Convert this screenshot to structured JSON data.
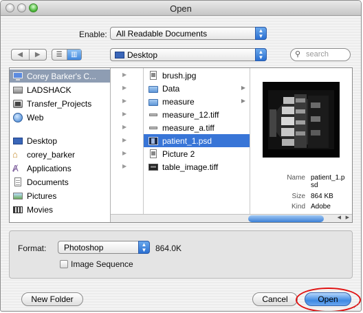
{
  "window": {
    "title": "Open"
  },
  "enable": {
    "label": "Enable:",
    "value": "All Readable Documents"
  },
  "location": {
    "value": "Desktop"
  },
  "search": {
    "placeholder": "search"
  },
  "sidebar": {
    "devices": [
      {
        "label": "Corey Barker's C...",
        "icon": "computer-icon",
        "selected": true
      },
      {
        "label": "LADSHACK",
        "icon": "drive-icon",
        "selected": false
      },
      {
        "label": "Transfer_Projects",
        "icon": "server-icon",
        "selected": false
      },
      {
        "label": "Web",
        "icon": "globe-icon",
        "selected": false
      }
    ],
    "places": [
      {
        "label": "Desktop",
        "icon": "desktop-icon"
      },
      {
        "label": "corey_barker",
        "icon": "home-icon"
      },
      {
        "label": "Applications",
        "icon": "applications-icon"
      },
      {
        "label": "Documents",
        "icon": "document-icon"
      },
      {
        "label": "Pictures",
        "icon": "pictures-icon"
      },
      {
        "label": "Movies",
        "icon": "movies-icon"
      }
    ]
  },
  "files": [
    {
      "name": "brush.jpg",
      "icon": "image-file-icon",
      "folder": false,
      "selected": false
    },
    {
      "name": "Data",
      "icon": "folder-icon",
      "folder": true,
      "selected": false
    },
    {
      "name": "measure",
      "icon": "folder-icon",
      "folder": true,
      "selected": false
    },
    {
      "name": "measure_12.tiff",
      "icon": "tiff-file-icon",
      "folder": false,
      "selected": false
    },
    {
      "name": "measure_a.tiff",
      "icon": "tiff-file-icon",
      "folder": false,
      "selected": false
    },
    {
      "name": "patient_1.psd",
      "icon": "psd-file-icon",
      "folder": false,
      "selected": true
    },
    {
      "name": "Picture 2",
      "icon": "image-file-icon",
      "folder": false,
      "selected": false
    },
    {
      "name": "table_image.tiff",
      "icon": "tiff-file-icon",
      "folder": false,
      "selected": false
    }
  ],
  "preview": {
    "name_label": "Name",
    "name_value_1": "patient_1.p",
    "name_value_2": "sd",
    "size_label": "Size",
    "size_value": "864 KB",
    "kind_label": "Kind",
    "kind_value": "Adobe"
  },
  "format": {
    "label": "Format:",
    "value": "Photoshop",
    "size": "864.0K",
    "sequence_label": "Image Sequence"
  },
  "buttons": {
    "new_folder": "New Folder",
    "cancel": "Cancel",
    "open": "Open"
  },
  "colors": {
    "selection": "#3875d7",
    "sidebar_selection": "#8e9db3",
    "annotation": "#e01010"
  }
}
